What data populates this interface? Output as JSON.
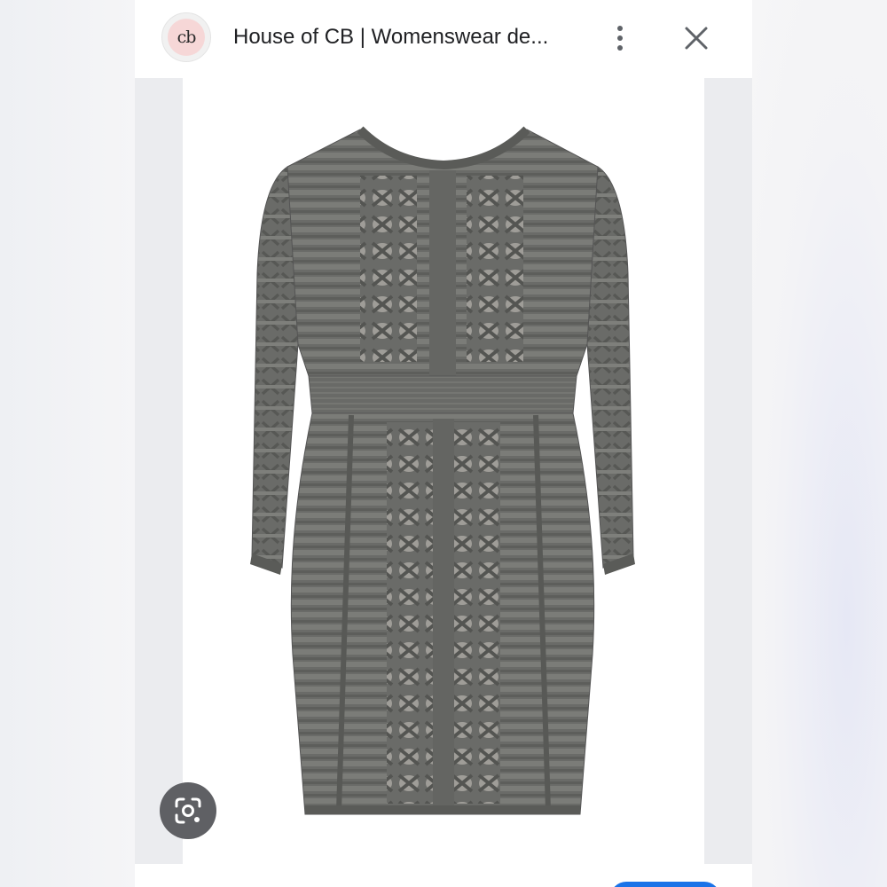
{
  "header": {
    "logo_text": "cb",
    "title": "House of CB | Womenswear de..."
  },
  "icons": {
    "menu": "more-vert-icon",
    "close": "close-icon",
    "lens": "lens-icon"
  },
  "image": {
    "alt": "Grey long-sleeve lattice bandage dress"
  },
  "colors": {
    "dress": "#6a6b68",
    "dress_dark": "#4f504d",
    "dress_light": "#8b8c88",
    "mesh": "#b7b5b0",
    "logo_bg": "#f6d7d7",
    "accent": "#1a73e8"
  }
}
